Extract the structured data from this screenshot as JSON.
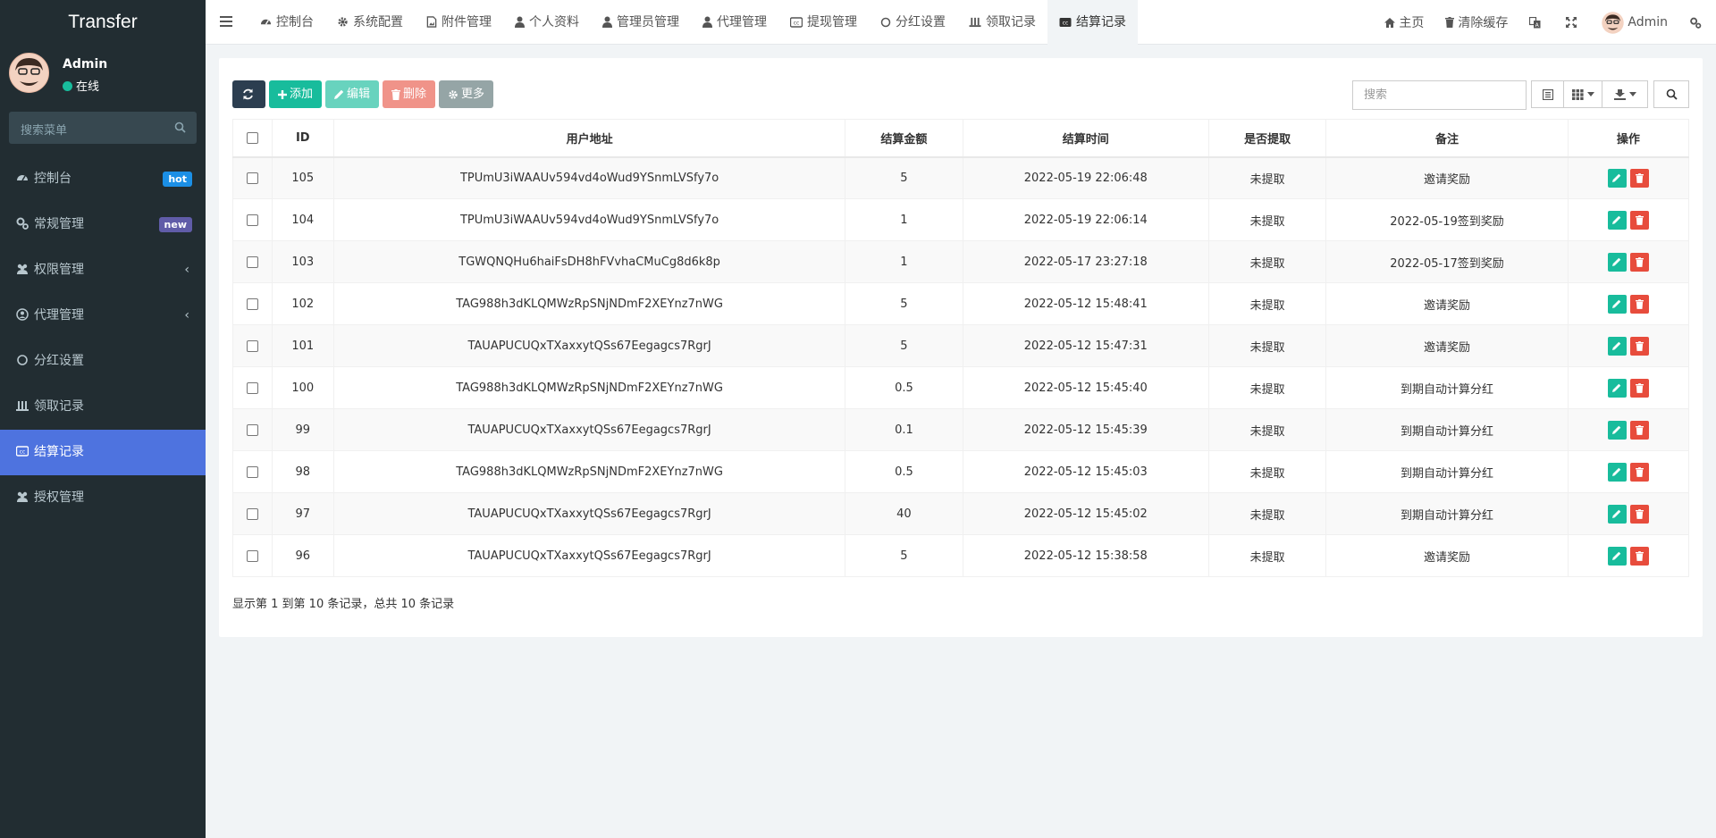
{
  "app": {
    "title": "Transfer"
  },
  "user": {
    "name": "Admin",
    "status": "在线"
  },
  "sidebar": {
    "search_placeholder": "搜索菜单",
    "items": [
      {
        "label": "控制台",
        "icon": "dashboard-icon",
        "badge": "hot",
        "badge_color": "#1b8fe6"
      },
      {
        "label": "常规管理",
        "icon": "cogs-icon",
        "badge": "new",
        "badge_color": "#605ca8"
      },
      {
        "label": "权限管理",
        "icon": "group-icon",
        "has_arrow": true
      },
      {
        "label": "代理管理",
        "icon": "user-circle-icon",
        "has_arrow": true
      },
      {
        "label": "分红设置",
        "icon": "circle-icon"
      },
      {
        "label": "领取记录",
        "icon": "stack-icon"
      },
      {
        "label": "结算记录",
        "icon": "cc-icon",
        "active": true
      },
      {
        "label": "授权管理",
        "icon": "group-icon"
      }
    ]
  },
  "topnav": {
    "tabs": [
      {
        "label": "控制台",
        "icon": "dashboard-icon"
      },
      {
        "label": "系统配置",
        "icon": "gear-icon"
      },
      {
        "label": "附件管理",
        "icon": "file-image-icon"
      },
      {
        "label": "个人资料",
        "icon": "user-icon"
      },
      {
        "label": "管理员管理",
        "icon": "user-icon"
      },
      {
        "label": "代理管理",
        "icon": "user-icon"
      },
      {
        "label": "提现管理",
        "icon": "cc-icon"
      },
      {
        "label": "分红设置",
        "icon": "circle-icon"
      },
      {
        "label": "领取记录",
        "icon": "stack-icon"
      },
      {
        "label": "结算记录",
        "icon": "cc-icon",
        "active": true
      }
    ],
    "right": {
      "home": "主页",
      "clear_cache": "清除缓存",
      "user": "Admin"
    }
  },
  "toolbar": {
    "add": "添加",
    "edit": "编辑",
    "delete": "删除",
    "more": "更多",
    "search_placeholder": "搜索"
  },
  "table": {
    "columns": [
      "ID",
      "用户地址",
      "结算金额",
      "结算时间",
      "是否提取",
      "备注",
      "操作"
    ],
    "rows": [
      {
        "id": "105",
        "address": "TPUmU3iWAAUv594vd4oWud9YSnmLVSfy7o",
        "amount": "5",
        "time": "2022-05-19 22:06:48",
        "withdrawn": "未提取",
        "remark": "邀请奖励"
      },
      {
        "id": "104",
        "address": "TPUmU3iWAAUv594vd4oWud9YSnmLVSfy7o",
        "amount": "1",
        "time": "2022-05-19 22:06:14",
        "withdrawn": "未提取",
        "remark": "2022-05-19签到奖励"
      },
      {
        "id": "103",
        "address": "TGWQNQHu6haiFsDH8hFVvhaCMuCg8d6k8p",
        "amount": "1",
        "time": "2022-05-17 23:27:18",
        "withdrawn": "未提取",
        "remark": "2022-05-17签到奖励"
      },
      {
        "id": "102",
        "address": "TAG988h3dKLQMWzRpSNjNDmF2XEYnz7nWG",
        "amount": "5",
        "time": "2022-05-12 15:48:41",
        "withdrawn": "未提取",
        "remark": "邀请奖励"
      },
      {
        "id": "101",
        "address": "TAUAPUCUQxTXaxxytQSs67Eegagcs7RgrJ",
        "amount": "5",
        "time": "2022-05-12 15:47:31",
        "withdrawn": "未提取",
        "remark": "邀请奖励"
      },
      {
        "id": "100",
        "address": "TAG988h3dKLQMWzRpSNjNDmF2XEYnz7nWG",
        "amount": "0.5",
        "time": "2022-05-12 15:45:40",
        "withdrawn": "未提取",
        "remark": "到期自动计算分红"
      },
      {
        "id": "99",
        "address": "TAUAPUCUQxTXaxxytQSs67Eegagcs7RgrJ",
        "amount": "0.1",
        "time": "2022-05-12 15:45:39",
        "withdrawn": "未提取",
        "remark": "到期自动计算分红"
      },
      {
        "id": "98",
        "address": "TAG988h3dKLQMWzRpSNjNDmF2XEYnz7nWG",
        "amount": "0.5",
        "time": "2022-05-12 15:45:03",
        "withdrawn": "未提取",
        "remark": "到期自动计算分红"
      },
      {
        "id": "97",
        "address": "TAUAPUCUQxTXaxxytQSs67Eegagcs7RgrJ",
        "amount": "40",
        "time": "2022-05-12 15:45:02",
        "withdrawn": "未提取",
        "remark": "到期自动计算分红"
      },
      {
        "id": "96",
        "address": "TAUAPUCUQxTXaxxytQSs67Eegagcs7RgrJ",
        "amount": "5",
        "time": "2022-05-12 15:38:58",
        "withdrawn": "未提取",
        "remark": "邀请奖励"
      }
    ]
  },
  "pagination": {
    "summary": "显示第 1 到第 10 条记录，总共 10 条记录"
  }
}
